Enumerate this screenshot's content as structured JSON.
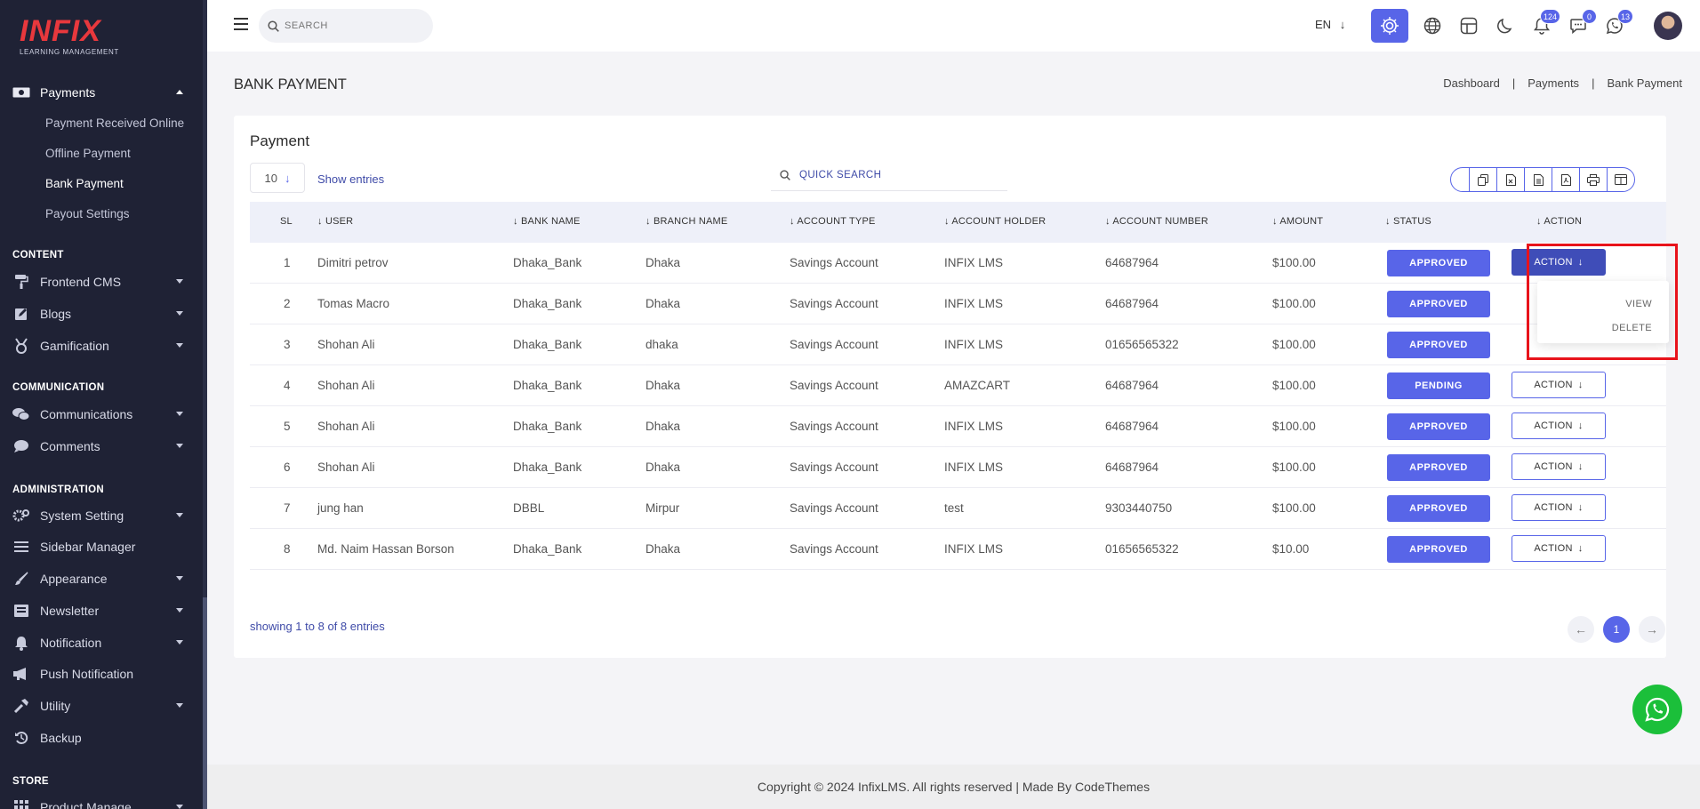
{
  "brand": {
    "logo_text": "INFIX",
    "logo_subtitle": "LEARNING MANAGEMENT"
  },
  "sidebar": {
    "payments": {
      "label": "Payments",
      "sub_items": [
        "Payment Received Online",
        "Offline Payment",
        "Bank Payment",
        "Payout Settings"
      ],
      "active_sub": "Bank Payment"
    },
    "sections": {
      "content": "CONTENT",
      "communication": "COMMUNICATION",
      "administration": "ADMINISTRATION",
      "store": "STORE"
    },
    "content_items": [
      "Frontend CMS",
      "Blogs",
      "Gamification"
    ],
    "communication_items": [
      "Communications",
      "Comments"
    ],
    "administration_items": [
      "System Setting",
      "Sidebar Manager",
      "Appearance",
      "Newsletter",
      "Notification",
      "Push Notification",
      "Utility",
      "Backup"
    ],
    "store_items": [
      "Product Manage"
    ]
  },
  "topbar": {
    "search_placeholder": "SEARCH",
    "language": "EN",
    "notifications_count": "124",
    "messages_count": "0",
    "whatsapp_count": "13"
  },
  "page": {
    "title": "BANK PAYMENT",
    "breadcrumb": [
      "Dashboard",
      "Payments",
      "Bank Payment"
    ]
  },
  "card": {
    "title": "Payment",
    "entries_value": "10",
    "show_entries_label": "Show entries",
    "quick_search_placeholder": "QUICK SEARCH",
    "showing_text": "showing 1 to 8 of 8 entries",
    "current_page": "1"
  },
  "table": {
    "headers": [
      "SL",
      "USER",
      "BANK NAME",
      "BRANCH NAME",
      "ACCOUNT TYPE",
      "ACCOUNT HOLDER",
      "ACCOUNT NUMBER",
      "AMOUNT",
      "STATUS",
      "ACTION"
    ],
    "rows": [
      {
        "sl": "1",
        "user": "Dimitri petrov",
        "bank": "Dhaka_Bank",
        "branch": "Dhaka",
        "type": "Savings Account",
        "holder": "INFIX LMS",
        "number": "64687964",
        "amount": "$100.00",
        "status": "APPROVED",
        "action": "ACTION"
      },
      {
        "sl": "2",
        "user": "Tomas Macro",
        "bank": "Dhaka_Bank",
        "branch": "Dhaka",
        "type": "Savings Account",
        "holder": "INFIX LMS",
        "number": "64687964",
        "amount": "$100.00",
        "status": "APPROVED",
        "action": "ACTION"
      },
      {
        "sl": "3",
        "user": "Shohan Ali",
        "bank": "Dhaka_Bank",
        "branch": "dhaka",
        "type": "Savings Account",
        "holder": "INFIX LMS",
        "number": "01656565322",
        "amount": "$100.00",
        "status": "APPROVED",
        "action": "ACTION"
      },
      {
        "sl": "4",
        "user": "Shohan Ali",
        "bank": "Dhaka_Bank",
        "branch": "Dhaka",
        "type": "Savings Account",
        "holder": "AMAZCART",
        "number": "64687964",
        "amount": "$100.00",
        "status": "PENDING",
        "action": "ACTION"
      },
      {
        "sl": "5",
        "user": "Shohan Ali",
        "bank": "Dhaka_Bank",
        "branch": "Dhaka",
        "type": "Savings Account",
        "holder": "INFIX LMS",
        "number": "64687964",
        "amount": "$100.00",
        "status": "APPROVED",
        "action": "ACTION"
      },
      {
        "sl": "6",
        "user": "Shohan Ali",
        "bank": "Dhaka_Bank",
        "branch": "Dhaka",
        "type": "Savings Account",
        "holder": "INFIX LMS",
        "number": "64687964",
        "amount": "$100.00",
        "status": "APPROVED",
        "action": "ACTION"
      },
      {
        "sl": "7",
        "user": "jung han",
        "bank": "DBBL",
        "branch": "Mirpur",
        "type": "Savings Account",
        "holder": "test",
        "number": "9303440750",
        "amount": "$100.00",
        "status": "APPROVED",
        "action": "ACTION"
      },
      {
        "sl": "8",
        "user": "Md. Naim Hassan Borson",
        "bank": "Dhaka_Bank",
        "branch": "Dhaka",
        "type": "Savings Account",
        "holder": "INFIX LMS",
        "number": "01656565322",
        "amount": "$10.00",
        "status": "APPROVED",
        "action": "ACTION"
      }
    ]
  },
  "action_menu": {
    "items": [
      "VIEW",
      "DELETE"
    ]
  },
  "footer": {
    "text": "Copyright © 2024 InfixLMS. All rights reserved | Made By CodeThemes"
  },
  "colors": {
    "primary": "#5865e8",
    "sidebar_bg": "#1f2235",
    "highlight": "#e8131b",
    "whatsapp": "#1bbf3a"
  }
}
